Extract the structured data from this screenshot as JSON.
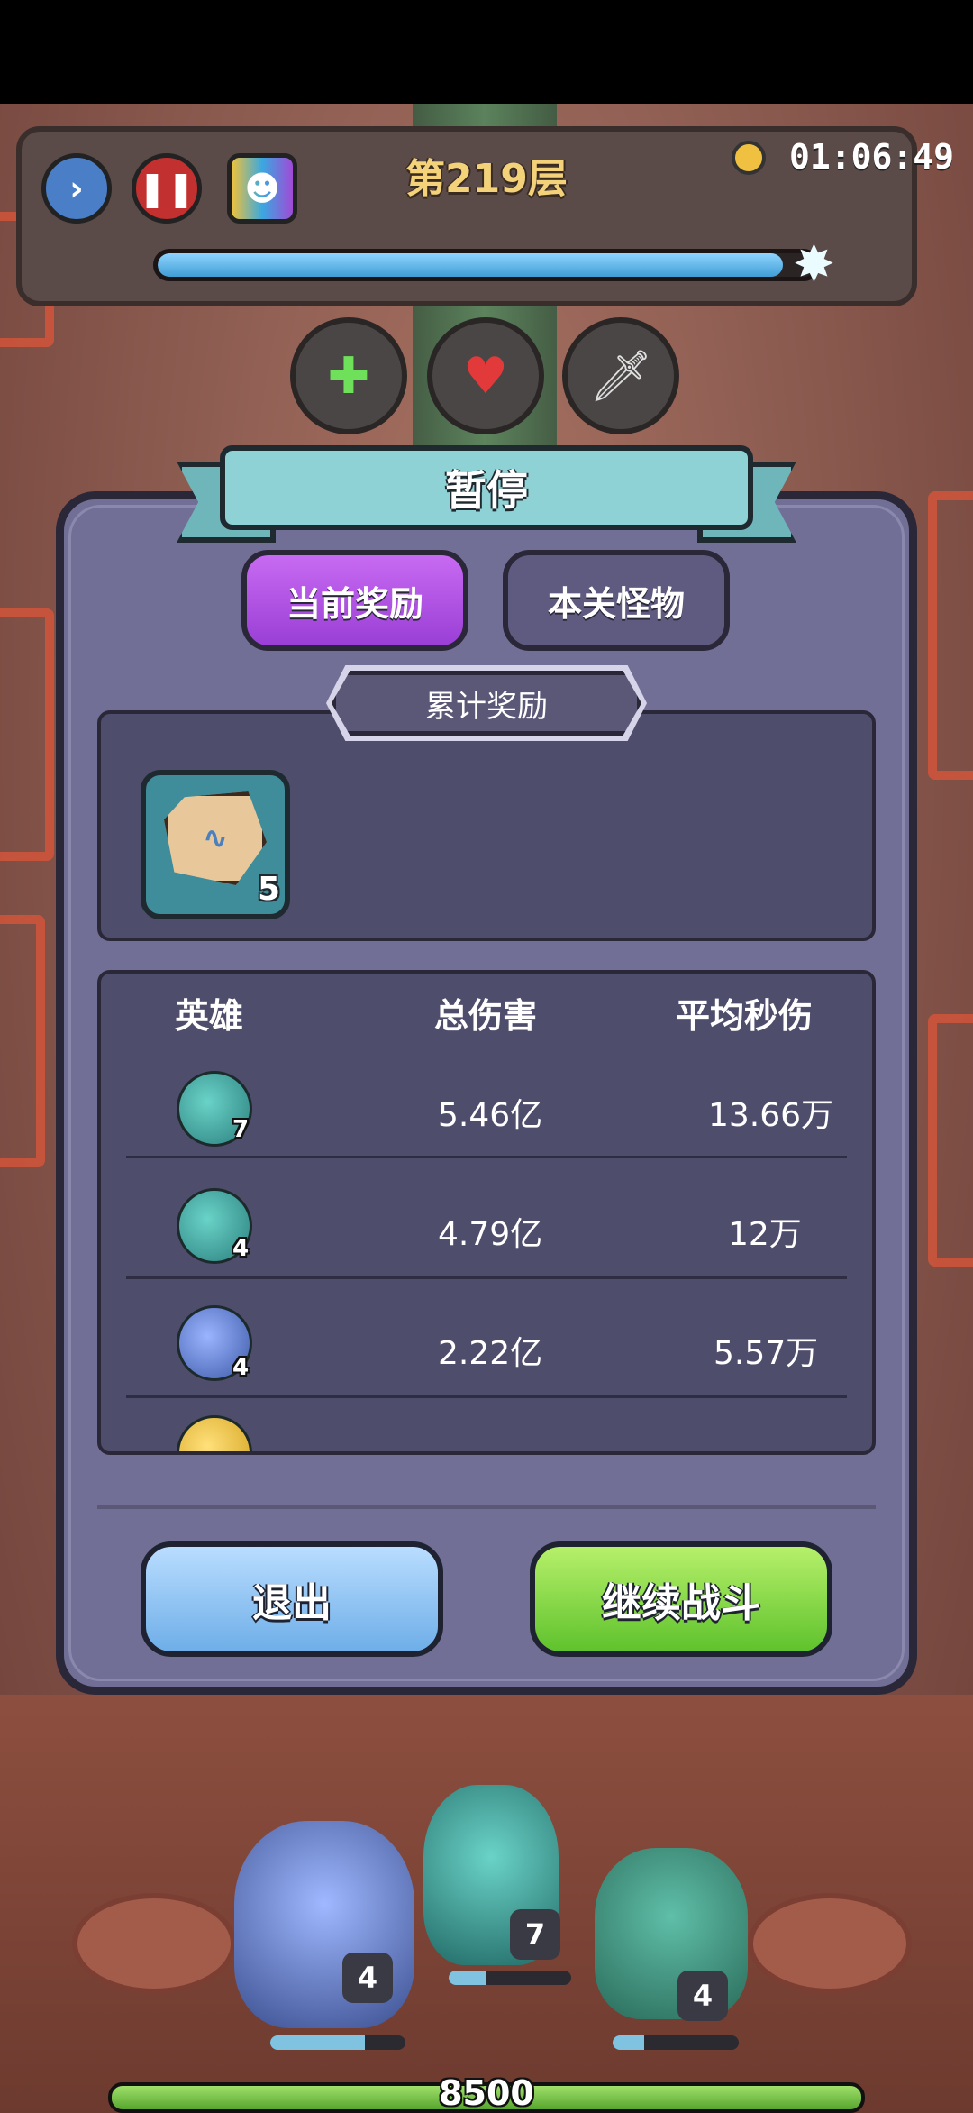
{
  "hud": {
    "level_title": "第219层",
    "timer": "01:06:49",
    "level_progress": 0.95,
    "buttons": [
      "forward-icon",
      "pause-icon",
      "card-deck-icon"
    ],
    "buffs": [
      "heal-lightning-icon",
      "heart-up-icon",
      "sword-shield-icon"
    ]
  },
  "panel": {
    "title": "暂停",
    "tabs": [
      {
        "label": "当前奖励",
        "active": true
      },
      {
        "label": "本关怪物",
        "active": false
      }
    ],
    "rewards_title": "累计奖励",
    "rewards": [
      {
        "icon": "rune-stone-icon",
        "count": "5"
      }
    ],
    "table": {
      "headers": [
        "英雄",
        "总伤害",
        "平均秒伤"
      ],
      "rows": [
        {
          "hero_icon": "teal-spirit-hero-icon",
          "level": "7",
          "total": "5.46亿",
          "dps": "13.66万"
        },
        {
          "hero_icon": "antler-bird-hero-icon",
          "level": "4",
          "total": "4.79亿",
          "dps": "12万"
        },
        {
          "hero_icon": "ice-knight-hero-icon",
          "level": "4",
          "total": "2.22亿",
          "dps": "5.57万"
        },
        {
          "hero_icon": "golden-beast-hero-icon",
          "level": "",
          "total": "",
          "dps": ""
        }
      ]
    },
    "exit_label": "退出",
    "continue_label": "继续战斗"
  },
  "battle": {
    "units": [
      {
        "name": "ice-knight",
        "level": "4"
      },
      {
        "name": "teal-spirit",
        "level": "7"
      },
      {
        "name": "antler-bird",
        "level": "4"
      }
    ],
    "base_hp": "8500"
  },
  "colors": {
    "panel": "#726f96",
    "active_tab": "#b456e8",
    "exit_button": "#8cc4f4",
    "continue_button": "#86d945"
  }
}
